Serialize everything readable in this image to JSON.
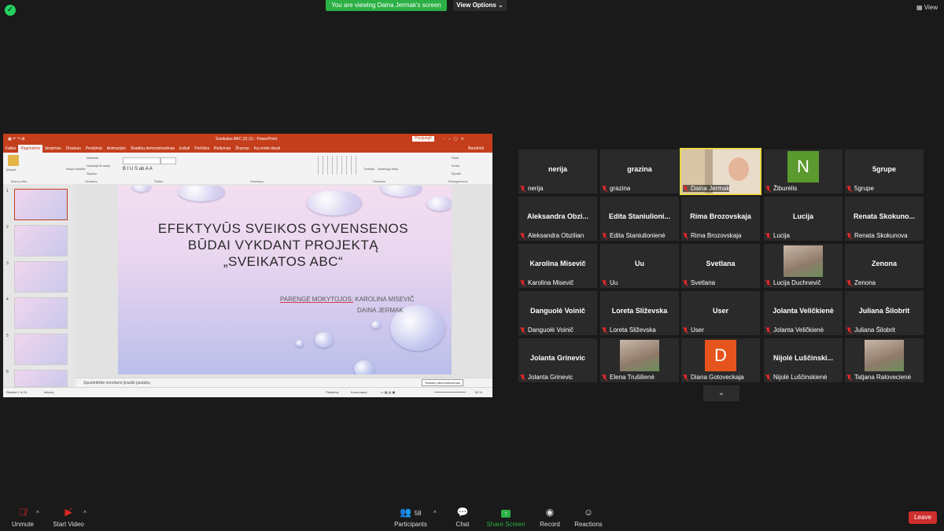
{
  "top": {
    "viewing_banner": "You are viewing Daina Jermak's screen",
    "view_options": "View Options",
    "view_button": "View"
  },
  "ppt": {
    "window_title": "Sveikatos ABC (2) (1)  -  PowerPoint",
    "share_button": "Prisijungti",
    "tabs": [
      "Failas",
      "Pagrindinis",
      "Įterpimas",
      "Dizainas",
      "Perėjimai",
      "Animacijos",
      "Skaidrių demonstravimas",
      "Įrašyti",
      "Peržiūra",
      "Rodymas",
      "Žinynas",
      "Ką norite daryti"
    ],
    "share_right": "Bendrinti",
    "ribbon_groups": [
      "Mainų sritis",
      "Skaidrės",
      "Šriftas",
      "Pastraipa",
      "Piešimas",
      "Redagavimas"
    ],
    "ribbon_items": {
      "paste": "Įklijuoti",
      "new_slide": "Nauja skaidrė",
      "layout": "Maketas",
      "reset": "Nustatyti iš naujo",
      "section": "Skyrius",
      "find": "Rasti",
      "replace": "Keisti",
      "select": "Žymėti",
      "arrange": "Tvarkyti",
      "quick_styles": "Sparčiųjų stilių"
    },
    "slide_numbers": [
      "1",
      "2",
      "3",
      "4",
      "5",
      "6"
    ],
    "slide": {
      "title_line1": "EFEKTYVŪS SVEIKOS GYVENSENOS",
      "title_line2": "BŪDAI VYKDANT PROJEKTĄ",
      "title_line3": "„SVEIKATOS ABC“",
      "prepared_label": "PARENGĖ MOKYTOJOS:",
      "author1": "KAROLINA MISEVIČ",
      "author2": "DAINA JERMAK"
    },
    "notes_placeholder": "Spustelėkite norėdami įtraukti pastabų",
    "status_left": "Skaidrė 1 iš 24",
    "status_lang": "lietuvių",
    "status_notes": "Pastabos",
    "status_comments": "Komentarai",
    "tooltip": "Skaidrių demonstravimas",
    "zoom": "82 %"
  },
  "gallery": [
    {
      "big": "nerija",
      "label": "nerija"
    },
    {
      "big": "grazina",
      "label": "grazina"
    },
    {
      "big": "",
      "label": "Daina Jermak",
      "video": true,
      "active": true
    },
    {
      "big": "N",
      "label": "Žiburėlis",
      "avatar_color": "#5a9a2e"
    },
    {
      "big": "5grupe",
      "label": "5grupe"
    },
    {
      "big": "Aleksandra  Obzi...",
      "label": "Aleksandra Obzilian"
    },
    {
      "big": "Edita  Staniulioni...",
      "label": "Edita Staniulionienė"
    },
    {
      "big": "Rima Brozovskaja",
      "label": "Rima Brozovskaja"
    },
    {
      "big": "Lucija",
      "label": "Lucija"
    },
    {
      "big": "Renata  Skokuno...",
      "label": "Renata Skokunova"
    },
    {
      "big": "Karolina Misevič",
      "label": "Karolina Misevič"
    },
    {
      "big": "Uu",
      "label": "Uu"
    },
    {
      "big": "Svetlana",
      "label": "Svetlana"
    },
    {
      "big": "",
      "label": "Lucija Duchnevič",
      "photo": true
    },
    {
      "big": "Zenona",
      "label": "Zenona"
    },
    {
      "big": "Danguolė Voinič",
      "label": "Danguolė Voinič"
    },
    {
      "big": "Loreta Sliževska",
      "label": "Loreta Sliževska"
    },
    {
      "big": "User",
      "label": "User"
    },
    {
      "big": "Jolanta Veličkienė",
      "label": "Jolanta Veličkienė"
    },
    {
      "big": "Juliana Šilobrit",
      "label": "Juliana Šilobrit"
    },
    {
      "big": "Jolanta Grinevic",
      "label": "Jolanta Grinevic"
    },
    {
      "big": "",
      "label": "Elena Trušilienė",
      "photo": true
    },
    {
      "big": "D",
      "label": "Diana Gotoveckaja",
      "avatar_color": "#e5541d"
    },
    {
      "big": "Nijolė  Luščinski...",
      "label": "Nijolė Luščinskienė"
    },
    {
      "big": "",
      "label": "Tatjana Ralovecienė",
      "photo": true
    }
  ],
  "toolbar": {
    "unmute": "Unmute",
    "start_video": "Start Video",
    "participants": "Participants",
    "participants_count": "58",
    "chat": "Chat",
    "share_screen": "Share Screen",
    "record": "Record",
    "reactions": "Reactions",
    "leave": "Leave"
  }
}
